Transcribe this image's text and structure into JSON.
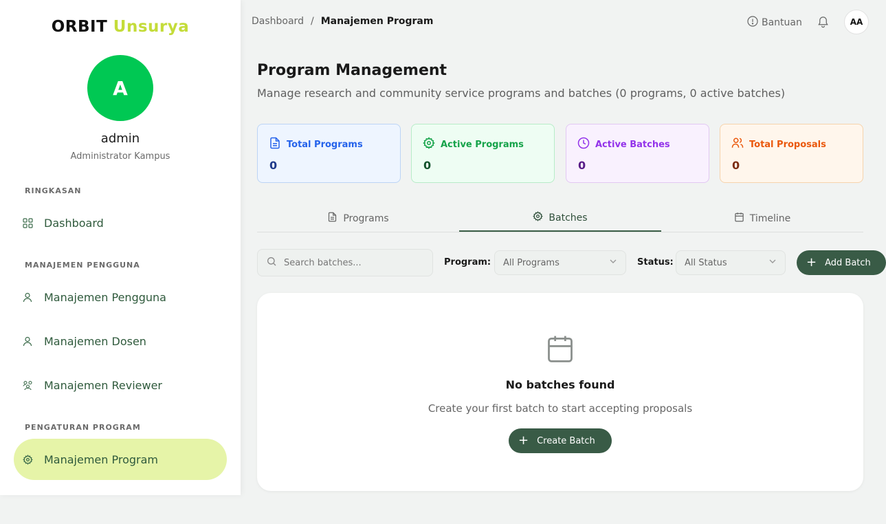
{
  "brand": {
    "part1": "ORBIT",
    "part2": "Unsurya"
  },
  "user": {
    "initial": "A",
    "name": "admin",
    "role": "Administrator Kampus"
  },
  "sidebar": {
    "sections": [
      {
        "label": "RINGKASAN"
      },
      {
        "label": "MANAJEMEN PENGGUNA"
      },
      {
        "label": "PENGATURAN PROGRAM"
      }
    ],
    "items": [
      {
        "label": "Dashboard",
        "icon": "grid-icon"
      },
      {
        "label": "Manajemen Pengguna",
        "icon": "user-icon"
      },
      {
        "label": "Manajemen Dosen",
        "icon": "user-icon"
      },
      {
        "label": "Manajemen Reviewer",
        "icon": "users-network-icon"
      },
      {
        "label": "Manajemen Program",
        "icon": "gear-icon",
        "active": true
      }
    ]
  },
  "topbar": {
    "breadcrumb": [
      "Dashboard",
      "Manajemen Program"
    ],
    "separator": "/",
    "help_label": "Bantuan",
    "avatar_initials": "AA"
  },
  "main": {
    "title": "Program Management",
    "subtitle": "Manage research and community service programs and batches (0 programs, 0 active batches)",
    "stats": [
      {
        "label": "Total Programs",
        "value": "0",
        "color": "#2563eb"
      },
      {
        "label": "Active Programs",
        "value": "0",
        "color": "#16a34a"
      },
      {
        "label": "Active Batches",
        "value": "0",
        "color": "#9333ea"
      },
      {
        "label": "Total Proposals",
        "value": "0",
        "color": "#ea580c"
      }
    ],
    "tabs": [
      {
        "label": "Programs"
      },
      {
        "label": "Batches",
        "active": true
      },
      {
        "label": "Timeline"
      }
    ],
    "filters": {
      "search_placeholder": "Search batches...",
      "program_label": "Program:",
      "program_value": "All Programs",
      "status_label": "Status:",
      "status_value": "All Status",
      "add_button": "Add Batch"
    },
    "empty": {
      "title": "No batches found",
      "message": "Create your first batch to start accepting proposals",
      "button": "Create Batch"
    }
  },
  "colors": {
    "accent": "#395b46",
    "active_nav": "#e6f4a8",
    "avatar": "#00c853",
    "brand_accent": "#c4dc3a"
  }
}
